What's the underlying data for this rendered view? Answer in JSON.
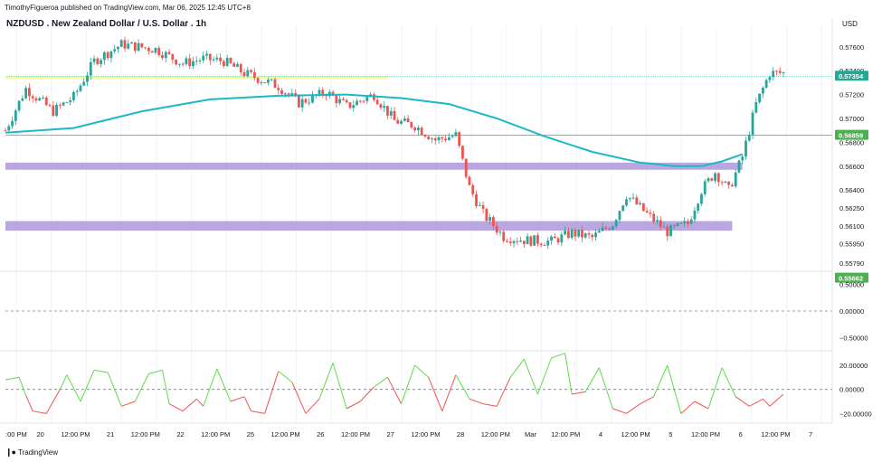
{
  "header": {
    "published": "TimothyFigueroa published on TradingView.com, Mar 06, 2025 12:45 UTC+8",
    "symbol_title": "NZDUSD . New Zealand Dollar / U.S. Dollar . 1h"
  },
  "brand": {
    "logo_icon": "tradingview-logo-icon",
    "name": "TradingView"
  },
  "colors": {
    "up": "#26a69a",
    "down": "#ef5350",
    "ma": "#1cb8c8",
    "zone": "#b39ddb",
    "yellow_line": "#fff59d",
    "price_label": "#22ab94",
    "green_line": "#4caf50",
    "osc_up": "#5ddc47",
    "osc_down": "#ef5350"
  },
  "price_axis": {
    "currency": "USD",
    "ticks": [
      "0.57600",
      "0.57400",
      "0.57200",
      "0.57000",
      "0.56800",
      "0.56600",
      "0.56400",
      "0.56250",
      "0.56100",
      "0.55950",
      "0.55790"
    ],
    "current_price": "0.57354",
    "level_label": "0.56859",
    "bottom_label": "0.55662"
  },
  "indicator1_axis": {
    "ticks": [
      "0.50000",
      "0.00000",
      "−0.50000"
    ]
  },
  "indicator2_axis": {
    "ticks": [
      "20.00000",
      "0.00000",
      "−20.00000"
    ]
  },
  "time_axis": {
    "labels": [
      ":00 PM",
      "20",
      "12:00 PM",
      "21",
      "12:00 PM",
      "22",
      "12:00 PM",
      "25",
      "12:00 PM",
      "26",
      "12:00 PM",
      "27",
      "12:00 PM",
      "28",
      "12:00 PM",
      "Mar",
      "12:00 PM",
      "4",
      "12:00 PM",
      "5",
      "12:00 PM",
      "6",
      "12:00 PM",
      "7"
    ]
  },
  "chart_data": [
    {
      "type": "candlestick",
      "title": "NZDUSD . New Zealand Dollar / U.S. Dollar . 1h",
      "ylim": [
        0.5572,
        0.5778
      ],
      "x_range_hours": [
        0,
        228
      ],
      "close_path": [
        [
          0,
          0.569
        ],
        [
          6,
          0.5725
        ],
        [
          14,
          0.5706
        ],
        [
          20,
          0.5718
        ],
        [
          26,
          0.5748
        ],
        [
          34,
          0.5762
        ],
        [
          44,
          0.5758
        ],
        [
          52,
          0.5746
        ],
        [
          58,
          0.575
        ],
        [
          64,
          0.5748
        ],
        [
          70,
          0.5738
        ],
        [
          80,
          0.5727
        ],
        [
          86,
          0.5713
        ],
        [
          94,
          0.5722
        ],
        [
          100,
          0.571
        ],
        [
          108,
          0.572
        ],
        [
          114,
          0.5698
        ],
        [
          120,
          0.5694
        ],
        [
          126,
          0.5682
        ],
        [
          132,
          0.5686
        ],
        [
          136,
          0.5642
        ],
        [
          140,
          0.562
        ],
        [
          146,
          0.5601
        ],
        [
          152,
          0.5598
        ],
        [
          160,
          0.5597
        ],
        [
          166,
          0.5604
        ],
        [
          172,
          0.56
        ],
        [
          178,
          0.5612
        ],
        [
          182,
          0.5636
        ],
        [
          188,
          0.562
        ],
        [
          194,
          0.5605
        ],
        [
          200,
          0.5612
        ],
        [
          204,
          0.564
        ],
        [
          208,
          0.5655
        ],
        [
          212,
          0.564
        ],
        [
          216,
          0.5668
        ],
        [
          220,
          0.5712
        ],
        [
          224,
          0.5738
        ],
        [
          228,
          0.5738
        ]
      ],
      "moving_average": [
        [
          0,
          0.5688
        ],
        [
          20,
          0.5692
        ],
        [
          40,
          0.5706
        ],
        [
          60,
          0.5716
        ],
        [
          80,
          0.5719
        ],
        [
          100,
          0.572
        ],
        [
          116,
          0.5717
        ],
        [
          130,
          0.5712
        ],
        [
          144,
          0.57
        ],
        [
          158,
          0.5685
        ],
        [
          172,
          0.5672
        ],
        [
          186,
          0.5663
        ],
        [
          196,
          0.566
        ],
        [
          204,
          0.566
        ],
        [
          210,
          0.5664
        ],
        [
          216,
          0.567
        ]
      ],
      "horizontal_lines": [
        {
          "kind": "yellow",
          "y": 0.5734,
          "x_start": 0,
          "x_end": 112
        },
        {
          "kind": "current-price",
          "y": 0.57354
        },
        {
          "kind": "green-level",
          "y": 0.56859
        }
      ],
      "zones": [
        {
          "y_top": 0.5663,
          "y_bottom": 0.5657,
          "x_start": 0,
          "x_end": 216
        },
        {
          "y_top": 0.5614,
          "y_bottom": 0.5606,
          "x_start": 0,
          "x_end": 213
        }
      ]
    },
    {
      "type": "line",
      "title": "",
      "ylim": [
        -0.75,
        0.75
      ],
      "reference_line": 0.0,
      "series": []
    },
    {
      "type": "line",
      "title": "",
      "ylim": [
        -28,
        32
      ],
      "reference_line": 0.0,
      "oscillator_path": [
        [
          0,
          8
        ],
        [
          4,
          10
        ],
        [
          6,
          -5
        ],
        [
          8,
          -18
        ],
        [
          12,
          -20
        ],
        [
          16,
          0
        ],
        [
          18,
          12
        ],
        [
          22,
          -10
        ],
        [
          26,
          16
        ],
        [
          30,
          14
        ],
        [
          34,
          -14
        ],
        [
          38,
          -10
        ],
        [
          42,
          13
        ],
        [
          46,
          16
        ],
        [
          48,
          -12
        ],
        [
          52,
          -18
        ],
        [
          56,
          -8
        ],
        [
          58,
          -14
        ],
        [
          62,
          17
        ],
        [
          66,
          -10
        ],
        [
          70,
          -6
        ],
        [
          72,
          -18
        ],
        [
          76,
          -20
        ],
        [
          80,
          15
        ],
        [
          84,
          6
        ],
        [
          88,
          -20
        ],
        [
          92,
          -8
        ],
        [
          96,
          22
        ],
        [
          100,
          -16
        ],
        [
          104,
          -10
        ],
        [
          108,
          2
        ],
        [
          112,
          10
        ],
        [
          116,
          -12
        ],
        [
          120,
          20
        ],
        [
          124,
          10
        ],
        [
          128,
          -18
        ],
        [
          132,
          12
        ],
        [
          136,
          -8
        ],
        [
          140,
          -12
        ],
        [
          144,
          -14
        ],
        [
          148,
          10
        ],
        [
          152,
          25
        ],
        [
          156,
          -4
        ],
        [
          160,
          26
        ],
        [
          164,
          30
        ],
        [
          166,
          -4
        ],
        [
          170,
          -2
        ],
        [
          174,
          18
        ],
        [
          178,
          -16
        ],
        [
          182,
          -20
        ],
        [
          186,
          -12
        ],
        [
          190,
          -6
        ],
        [
          194,
          20
        ],
        [
          198,
          -20
        ],
        [
          202,
          -10
        ],
        [
          206,
          -16
        ],
        [
          210,
          18
        ],
        [
          214,
          -6
        ],
        [
          218,
          -14
        ],
        [
          222,
          -8
        ],
        [
          224,
          -14
        ],
        [
          228,
          -4
        ]
      ]
    }
  ]
}
